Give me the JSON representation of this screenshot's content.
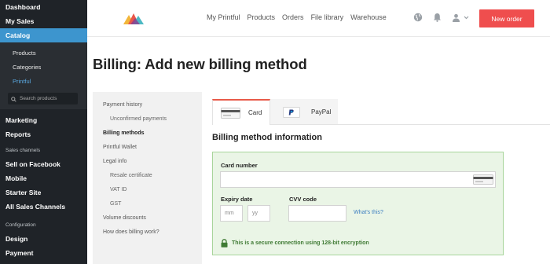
{
  "sidebar": {
    "items_top": [
      {
        "label": "Dashboard"
      },
      {
        "label": "My Sales"
      },
      {
        "label": "Catalog",
        "active": true
      }
    ],
    "catalog_sub": [
      {
        "label": "Products"
      },
      {
        "label": "Categories"
      },
      {
        "label": "Printful",
        "current": true
      }
    ],
    "search_placeholder": "Search products",
    "items_mid": [
      {
        "label": "Marketing"
      },
      {
        "label": "Reports"
      }
    ],
    "sales_channels_heading": "Sales channels",
    "channels": [
      {
        "label": "Sell on Facebook"
      },
      {
        "label": "Mobile"
      },
      {
        "label": "Starter Site"
      },
      {
        "label": "All Sales Channels"
      }
    ],
    "configuration_heading": "Configuration",
    "config_items": [
      {
        "label": "Design"
      },
      {
        "label": "Payment"
      }
    ]
  },
  "header": {
    "nav": [
      "My Printful",
      "Products",
      "Orders",
      "File library",
      "Warehouse"
    ],
    "icons": [
      "globe-icon",
      "bell-icon",
      "user-icon",
      "chevron-down-icon"
    ],
    "new_order_label": "New order"
  },
  "page": {
    "title": "Billing: Add new billing method"
  },
  "billing_menu": [
    {
      "label": "Payment history",
      "sub": false
    },
    {
      "label": "Unconfirmed payments",
      "sub": true
    },
    {
      "label": "Billing methods",
      "sub": false,
      "active": true
    },
    {
      "label": "Printful Wallet",
      "sub": false
    },
    {
      "label": "Legal info",
      "sub": false
    },
    {
      "label": "Resale certificate",
      "sub": true
    },
    {
      "label": "VAT ID",
      "sub": true
    },
    {
      "label": "GST",
      "sub": true
    },
    {
      "label": "Volume discounts",
      "sub": false
    },
    {
      "label": "How does billing work?",
      "sub": false
    }
  ],
  "tabs": {
    "card_label": "Card",
    "paypal_label": "PayPal"
  },
  "form": {
    "section_title": "Billing method information",
    "card_number_label": "Card number",
    "card_number_value": "",
    "expiry_label": "Expiry date",
    "mm_placeholder": "mm",
    "yy_placeholder": "yy",
    "cvv_label": "CVV code",
    "cvv_value": "",
    "whats_this": "What's this?",
    "secure_text": "This is a secure connection using 128-bit encryption"
  },
  "colors": {
    "sidebar_bg": "#1f2328",
    "sidebar_active": "#3d95ce",
    "accent_red": "#ef4e4e",
    "panel_bg": "#eaf5e6",
    "panel_border": "#a8d59b",
    "secure_green": "#3f7a34"
  }
}
